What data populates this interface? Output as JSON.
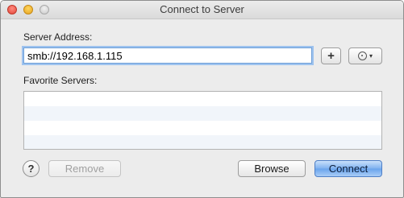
{
  "window": {
    "title": "Connect to Server"
  },
  "server_address": {
    "label": "Server Address:",
    "value": "smb://192.168.1.115"
  },
  "toolbar": {
    "add_label": "+",
    "recent_icon": "clock-icon",
    "recent_caret": "▾"
  },
  "favorites": {
    "label": "Favorite Servers:",
    "items": []
  },
  "footer": {
    "help_label": "?",
    "remove_label": "Remove",
    "browse_label": "Browse",
    "connect_label": "Connect"
  },
  "colors": {
    "accent": "#6ea6ec",
    "focus_ring": "#9ec3ef",
    "close": "#e2463a",
    "minimize": "#e5a323"
  }
}
